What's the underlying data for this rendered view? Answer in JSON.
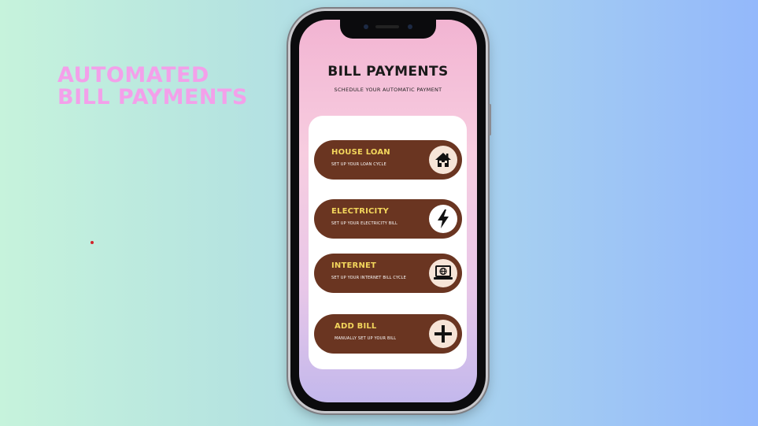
{
  "hero": {
    "line1": "AUTOMATED",
    "line2": "BILL PAYMENTS",
    "color": "#f3a0ea"
  },
  "app": {
    "title": "BILL PAYMENTS",
    "subtitle": "SCHEDULE YOUR AUTOMATIC PAYMENT"
  },
  "bills": [
    {
      "name": "HOUSE LOAN",
      "description": "SET UP YOUR LOAN CYCLE",
      "icon": "house-icon"
    },
    {
      "name": "ELECTRICITY",
      "description": "SET UP YOUR ELECTRICITY BILL",
      "icon": "lightning-bolt-icon"
    },
    {
      "name": "INTERNET",
      "description": "SET UP YOUR INTERNET BILL CYCLE",
      "icon": "laptop-globe-icon"
    },
    {
      "name": "ADD BILL",
      "description": "MANUALLY SET UP YOUR BILL",
      "icon": "plus-icon"
    }
  ],
  "colors": {
    "pill": "#6a3521",
    "pill_title": "#f3d65c",
    "icon_bg": "#f6e4d7"
  }
}
